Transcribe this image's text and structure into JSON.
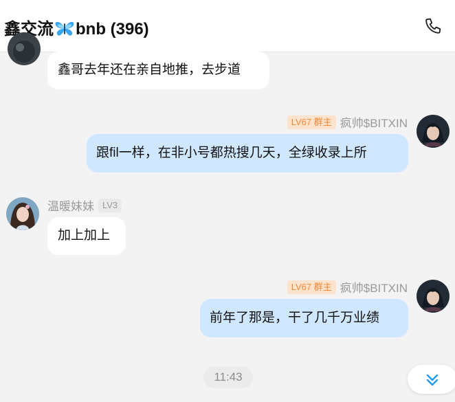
{
  "header": {
    "title_prefix": "鑫交流",
    "title_suffix": "bnb (396)",
    "icons": [
      "butterfly-emoji",
      "phone-icon"
    ]
  },
  "messages": [
    {
      "side": "left",
      "text": "鑫哥去年还在亲自地推，去步道"
    },
    {
      "side": "right",
      "role_badge": "LV67 群主",
      "sender": "疯帅$BITXIN",
      "text": "跟fil一样，在非小号都热搜几天，全绿收录上所"
    },
    {
      "side": "left",
      "sender": "温暖妹妹",
      "level_badge": "LV3",
      "text": "加上加上"
    },
    {
      "side": "right",
      "role_badge": "LV67 群主",
      "sender": "疯帅$BITXIN",
      "text": "前年了那是，干了几千万业绩"
    }
  ],
  "timestamp": "11:43",
  "colors": {
    "bubble_right": "#cfe7ff",
    "bubble_left": "#ffffff",
    "role_badge_bg": "#fde2cc",
    "role_badge_text": "#f08a3c",
    "scroll_arrow": "#1e9bf0"
  }
}
